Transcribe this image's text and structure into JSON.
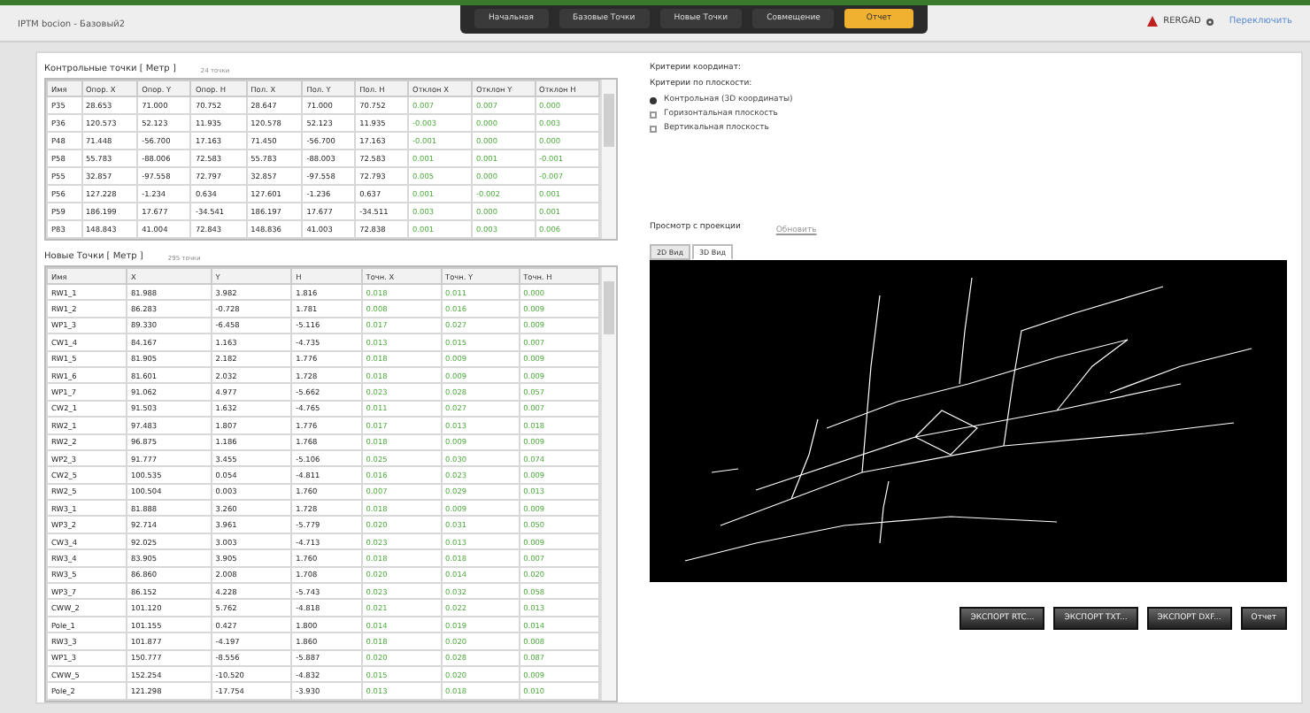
{
  "header": {
    "title": "IPTM bocion - Базовый2",
    "brand": "RERGAD",
    "account_link": "Переключить",
    "nav": [
      {
        "label": "Начальная",
        "selected": false
      },
      {
        "label": "Базовые Точки",
        "selected": false
      },
      {
        "label": "Новые Точки",
        "selected": false
      },
      {
        "label": "Совмещение",
        "selected": false
      },
      {
        "label": "Отчет",
        "selected": true
      }
    ]
  },
  "control_points": {
    "title": "Контрольные точки [ Метр ]",
    "count": "24 точки",
    "columns": [
      "Имя",
      "Опор. X",
      "Опор. Y",
      "Опор. H",
      "Пол. X",
      "Пол. Y",
      "Пол. H",
      "Отклон X",
      "Отклон Y",
      "Отклон H"
    ],
    "rows": [
      [
        "P35",
        "28.653",
        "71.000",
        "70.752",
        "28.647",
        "71.000",
        "70.752",
        "0.007",
        "0.007",
        "0.000"
      ],
      [
        "P36",
        "120.573",
        "52.123",
        "11.935",
        "120.578",
        "52.123",
        "11.935",
        "-0.003",
        "0.000",
        "0.003"
      ],
      [
        "P48",
        "71.448",
        "-56.700",
        "17.163",
        "71.450",
        "-56.700",
        "17.163",
        "-0.001",
        "0.000",
        "0.000"
      ],
      [
        "P58",
        "55.783",
        "-88.006",
        "72.583",
        "55.783",
        "-88.003",
        "72.583",
        "0.001",
        "0.001",
        "-0.001"
      ],
      [
        "P55",
        "32.857",
        "-97.558",
        "72.797",
        "32.857",
        "-97.558",
        "72.793",
        "0.005",
        "0.000",
        "-0.007"
      ],
      [
        "P56",
        "127.228",
        "-1.234",
        "0.634",
        "127.601",
        "-1.236",
        "0.637",
        "0.001",
        "-0.002",
        "0.001"
      ],
      [
        "P59",
        "186.199",
        "17.677",
        "-34.541",
        "186.197",
        "17.677",
        "-34.511",
        "0.003",
        "0.000",
        "0.001"
      ],
      [
        "P83",
        "148.843",
        "41.004",
        "72.843",
        "148.836",
        "41.003",
        "72.838",
        "0.001",
        "0.003",
        "0.006"
      ]
    ]
  },
  "new_points": {
    "title": "Новые Точки [ Метр ]",
    "count": "295 точки",
    "columns": [
      "Имя",
      "X",
      "Y",
      "H",
      "Точн. X",
      "Точн. Y",
      "Точн. H"
    ],
    "rows": [
      [
        "RW1_1",
        "81.988",
        "3.982",
        "1.816",
        "0.018",
        "0.011",
        "0.000"
      ],
      [
        "RW1_2",
        "86.283",
        "-0.728",
        "1.781",
        "0.008",
        "0.016",
        "0.009"
      ],
      [
        "WP1_3",
        "89.330",
        "-6.458",
        "-5.116",
        "0.017",
        "0.027",
        "0.009"
      ],
      [
        "CW1_4",
        "84.167",
        "1.163",
        "-4.735",
        "0.013",
        "0.015",
        "0.007"
      ],
      [
        "RW1_5",
        "81.905",
        "2.182",
        "1.776",
        "0.018",
        "0.009",
        "0.009"
      ],
      [
        "RW1_6",
        "81.601",
        "2.032",
        "1.728",
        "0.018",
        "0.009",
        "0.009"
      ],
      [
        "WP1_7",
        "91.062",
        "4.977",
        "-5.662",
        "0.023",
        "0.028",
        "0.057"
      ],
      [
        "CW2_1",
        "91.503",
        "1.632",
        "-4.765",
        "0.011",
        "0.027",
        "0.007"
      ],
      [
        "RW2_1",
        "97.483",
        "1.807",
        "1.776",
        "0.017",
        "0.013",
        "0.018"
      ],
      [
        "RW2_2",
        "96.875",
        "1.186",
        "1.768",
        "0.018",
        "0.009",
        "0.009"
      ],
      [
        "WP2_3",
        "91.777",
        "3.455",
        "-5.106",
        "0.025",
        "0.030",
        "0.074"
      ],
      [
        "CW2_5",
        "100.535",
        "0.054",
        "-4.811",
        "0.016",
        "0.023",
        "0.009"
      ],
      [
        "RW2_5",
        "100.504",
        "0.003",
        "1.760",
        "0.007",
        "0.029",
        "0.013"
      ],
      [
        "RW3_1",
        "81.888",
        "3.260",
        "1.728",
        "0.018",
        "0.009",
        "0.009"
      ],
      [
        "WP3_2",
        "92.714",
        "3.961",
        "-5.779",
        "0.020",
        "0.031",
        "0.050"
      ],
      [
        "CW3_4",
        "92.025",
        "3.003",
        "-4.713",
        "0.023",
        "0.013",
        "0.009"
      ],
      [
        "RW3_4",
        "83.905",
        "3.905",
        "1.760",
        "0.018",
        "0.018",
        "0.007"
      ],
      [
        "RW3_5",
        "86.860",
        "2.008",
        "1.708",
        "0.020",
        "0.014",
        "0.020"
      ],
      [
        "WP3_7",
        "86.152",
        "4.228",
        "-5.743",
        "0.023",
        "0.032",
        "0.058"
      ],
      [
        "CWW_2",
        "101.120",
        "5.762",
        "-4.818",
        "0.021",
        "0.022",
        "0.013"
      ],
      [
        "Pole_1",
        "101.155",
        "0.427",
        "1.800",
        "0.014",
        "0.019",
        "0.014"
      ],
      [
        "RW3_3",
        "101.877",
        "-4.197",
        "1.860",
        "0.018",
        "0.020",
        "0.008"
      ],
      [
        "WP1_3",
        "150.777",
        "-8.556",
        "-5.887",
        "0.020",
        "0.028",
        "0.087"
      ],
      [
        "CWW_5",
        "152.254",
        "-10.520",
        "-4.832",
        "0.015",
        "0.020",
        "0.009"
      ],
      [
        "Pole_2",
        "121.298",
        "-17.754",
        "-3.930",
        "0.013",
        "0.018",
        "0.010"
      ]
    ]
  },
  "criteria": {
    "title": "Критерии координат:",
    "subtitle": "Критерии по плоскости:",
    "options": [
      {
        "label": "Контрольная (3D координаты)",
        "selected": true
      },
      {
        "label": "Горизонтальная плоскость",
        "selected": false
      },
      {
        "label": "Вертикальная плоскость",
        "selected": false
      }
    ]
  },
  "view": {
    "title": "Просмотр с проекции",
    "link": "Обновить",
    "tabs": [
      {
        "label": "2D Вид",
        "selected": false
      },
      {
        "label": "3D Вид",
        "selected": true
      }
    ]
  },
  "buttons": [
    "ЭКСПОРТ RTC...",
    "ЭКСПОРТ TXT...",
    "ЭКСПОРТ DXF...",
    "Отчет"
  ]
}
